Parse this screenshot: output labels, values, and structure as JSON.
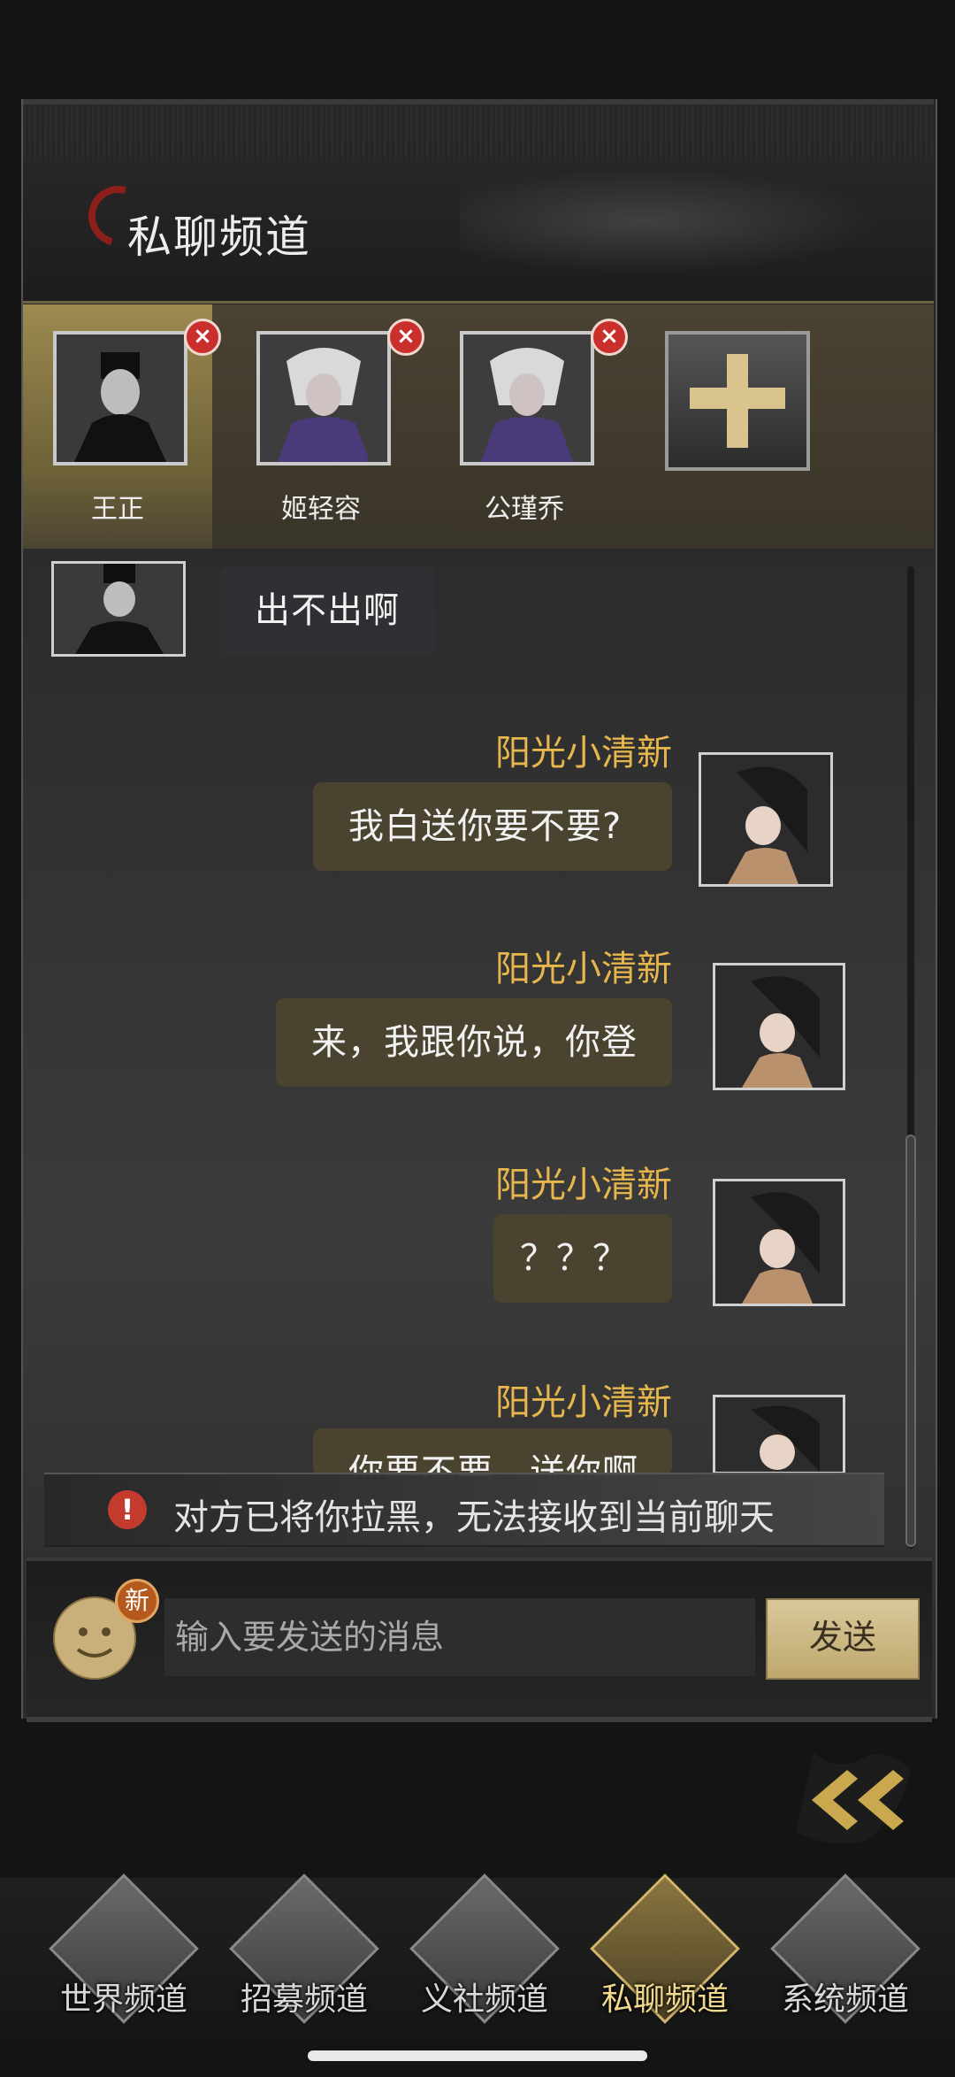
{
  "header": {
    "title": "私聊频道"
  },
  "contacts": [
    {
      "name": "王正",
      "selected": true,
      "closable": true
    },
    {
      "name": "姬轻容",
      "selected": false,
      "closable": true
    },
    {
      "name": "公瑾乔",
      "selected": false,
      "closable": true
    }
  ],
  "contact_close_symbol": "×",
  "add_contact_icon": "plus-icon",
  "messages": [
    {
      "side": "left",
      "text": "出不出啊"
    },
    {
      "side": "right",
      "sender": "阳光小清新",
      "text": "我白送你要不要?"
    },
    {
      "side": "right",
      "sender": "阳光小清新",
      "text": "来，我跟你说，你登"
    },
    {
      "side": "right",
      "sender": "阳光小清新",
      "text": "？？？"
    },
    {
      "side": "right",
      "sender": "阳光小清新",
      "text": "你要不要，送你啊"
    }
  ],
  "notice": {
    "icon": "!",
    "text": "对方已将你拉黑，无法接收到当前聊天"
  },
  "composer": {
    "badge": "新",
    "placeholder": "输入要发送的消息",
    "send_label": "发送"
  },
  "nav": [
    {
      "label": "世界频道",
      "active": false
    },
    {
      "label": "招募频道",
      "active": false
    },
    {
      "label": "义社频道",
      "active": false
    },
    {
      "label": "私聊频道",
      "active": true
    },
    {
      "label": "系统频道",
      "active": false
    }
  ],
  "colors": {
    "accent": "#e7b64c",
    "selected_contact": "#9c8a4f",
    "warning": "#c43a2c"
  }
}
